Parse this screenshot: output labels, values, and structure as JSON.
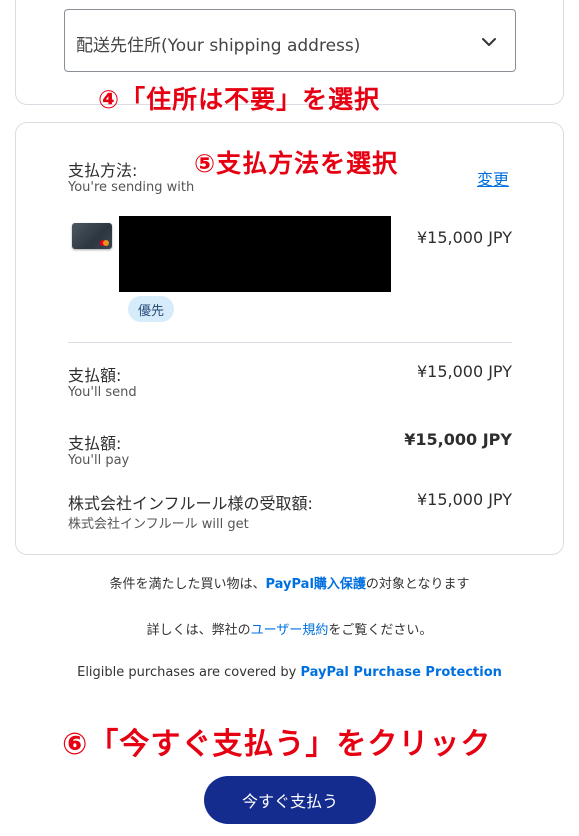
{
  "shipping": {
    "select_value": "配送先住所(Your shipping address)",
    "chevron_icon": "chevron-down-icon"
  },
  "annotations": {
    "step4": "④「住所は不要」を選択",
    "step5": "⑤支払方法を選択",
    "step6": "⑥「今すぐ支払う」をクリック"
  },
  "payment_method": {
    "label": "支払方法:",
    "sub": "You're sending with",
    "change_link": "変更",
    "card_icon": "credit-card-icon",
    "amount": "¥15,000 JPY",
    "priority_badge": "優先"
  },
  "summary": [
    {
      "label": "支払額:",
      "sub": "You'll send",
      "amount": "¥15,000 JPY",
      "bold": false
    },
    {
      "label": "支払額:",
      "sub": "You'll pay",
      "amount": "¥15,000 JPY",
      "bold": true
    },
    {
      "label": "株式会社インフルール様の受取額:",
      "sub": "株式会社インフルール will get",
      "amount": "¥15,000 JPY",
      "bold": false
    }
  ],
  "protection": {
    "line1_pre": "条件を満たした買い物は、",
    "line1_link": "PayPal購入保護",
    "line1_post": "の対象となります",
    "line2_pre": "詳しくは、弊社の",
    "line2_link": "ユーザー規約",
    "line2_post": "をご覧ください。",
    "line3_pre": "Eligible purchases are covered by ",
    "line3_link": "PayPal Purchase Protection"
  },
  "pay_button": "今すぐ支払う",
  "colors": {
    "accent_red": "#e60012",
    "link_blue": "#0070e0",
    "button_navy": "#142c8e"
  }
}
